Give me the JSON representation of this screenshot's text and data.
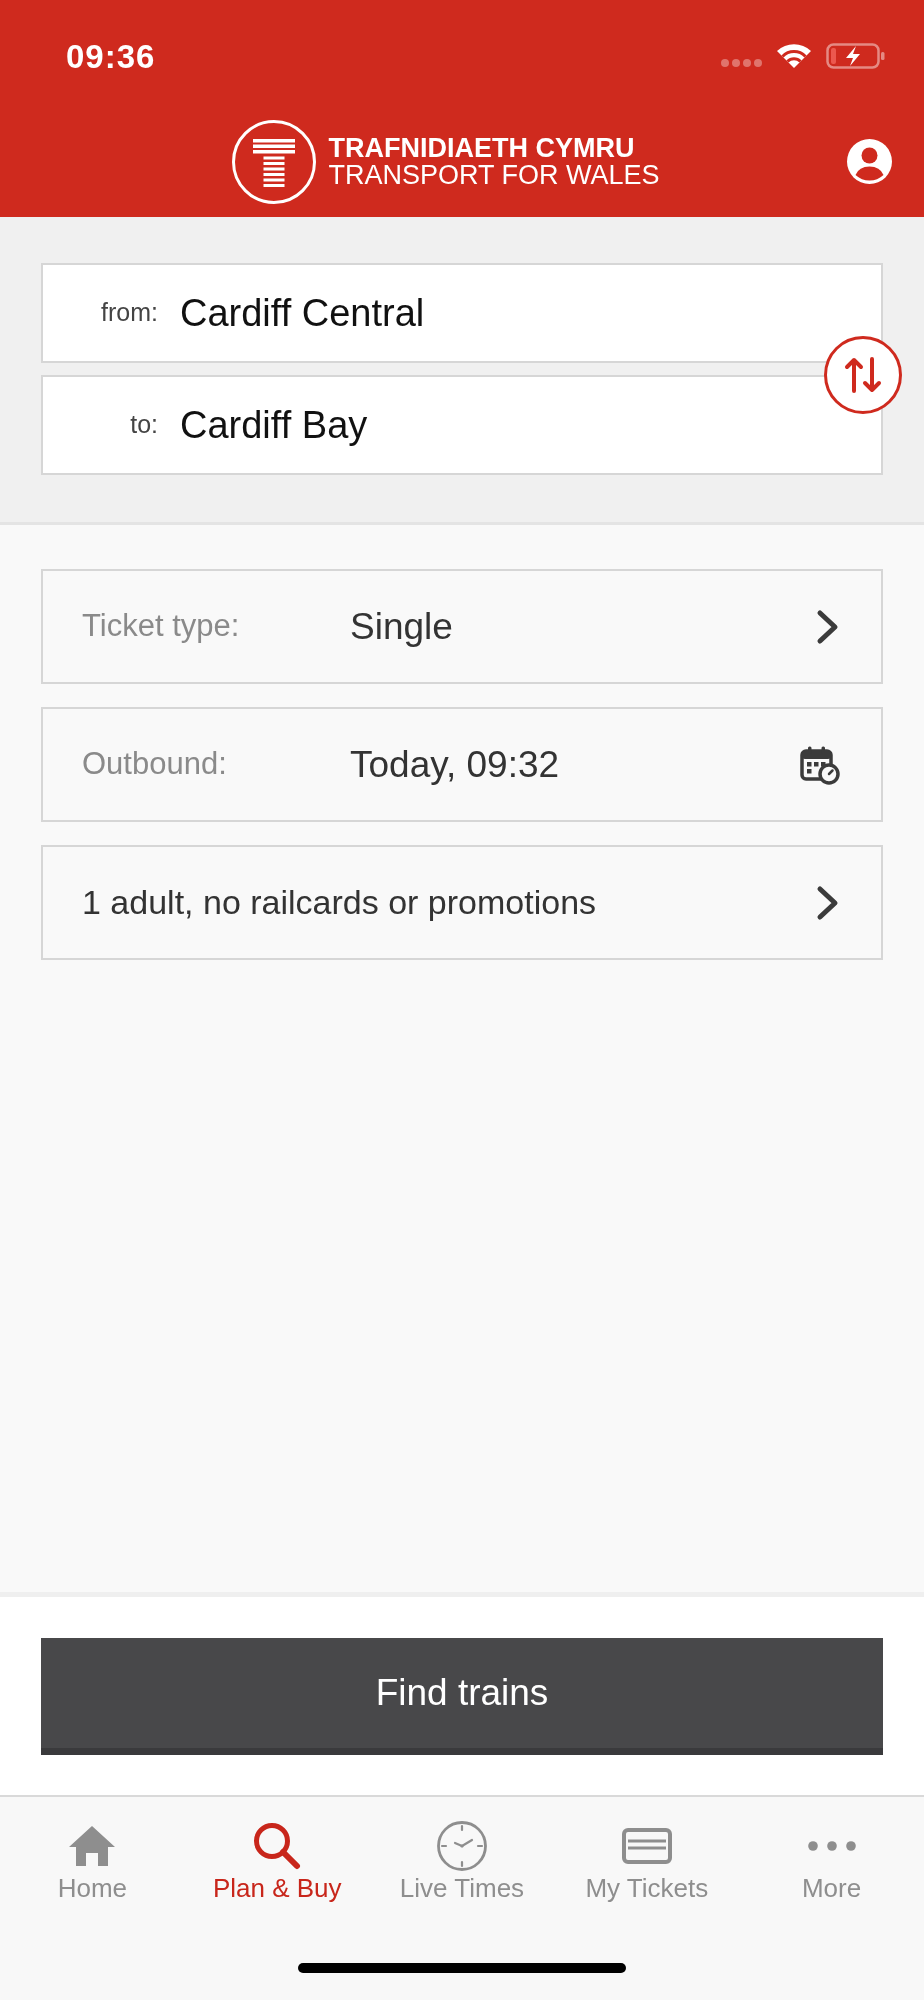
{
  "status_bar": {
    "time": "09:36"
  },
  "header": {
    "logo_text": [
      "TRAFNIDIAETH CYMRU",
      "TRANSPORT FOR WALES"
    ]
  },
  "journey": [
    {
      "label": "from:",
      "value": "Cardiff Central"
    },
    {
      "label": "to:",
      "value": "Cardiff Bay"
    }
  ],
  "options": [
    {
      "kind": "select",
      "label": "Ticket type:",
      "value": "Single"
    },
    {
      "kind": "date",
      "label": "Outbound:",
      "value": "Today, 09:32"
    },
    {
      "kind": "select",
      "value": "1 adult, no railcards or promotions"
    }
  ],
  "find_button": {
    "label": "Find trains"
  },
  "tab_bar": [
    {
      "label": "Home",
      "selected": false
    },
    {
      "label": "Plan & Buy",
      "selected": true
    },
    {
      "label": "Live Times",
      "selected": false
    },
    {
      "label": "My Tickets",
      "selected": false
    },
    {
      "label": "More",
      "selected": false
    }
  ]
}
